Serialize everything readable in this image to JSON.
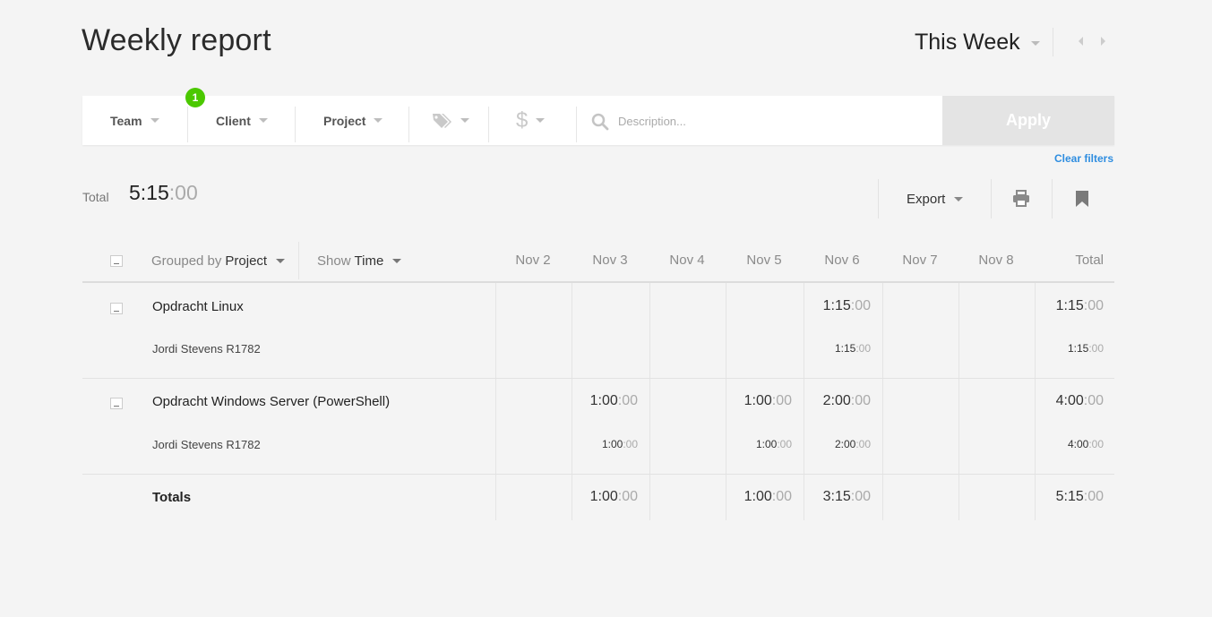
{
  "page": {
    "title": "Weekly report"
  },
  "period": {
    "label": "This Week"
  },
  "filters": {
    "team": "Team",
    "team_badge": "1",
    "client": "Client",
    "project": "Project",
    "tags_icon": "tag-icon",
    "billable_icon": "dollar-icon",
    "description_placeholder": "Description...",
    "apply": "Apply",
    "clear": "Clear filters"
  },
  "summary": {
    "total_label": "Total",
    "total_main": "5:15",
    "total_sec": ":00"
  },
  "toolbar": {
    "export": "Export",
    "print_icon": "print-icon",
    "bookmark_icon": "bookmark-icon"
  },
  "table": {
    "grouped_prefix": "Grouped by",
    "grouped_value": "Project",
    "show_prefix": "Show",
    "show_value": "Time",
    "days": [
      "Nov 2",
      "Nov 3",
      "Nov 4",
      "Nov 5",
      "Nov 6",
      "Nov 7",
      "Nov 8"
    ],
    "total_header": "Total",
    "groups": [
      {
        "name": "Opdracht Linux",
        "times": {
          "nov6": {
            "main": "1:15",
            "sec": ":00"
          },
          "total": {
            "main": "1:15",
            "sec": ":00"
          }
        },
        "user": "Jordi Stevens R1782",
        "user_times": {
          "nov6": {
            "main": "1:15",
            "sec": ":00"
          },
          "total": {
            "main": "1:15",
            "sec": ":00"
          }
        }
      },
      {
        "name": "Opdracht Windows Server (PowerShell)",
        "times": {
          "nov3": {
            "main": "1:00",
            "sec": ":00"
          },
          "nov5": {
            "main": "1:00",
            "sec": ":00"
          },
          "nov6": {
            "main": "2:00",
            "sec": ":00"
          },
          "total": {
            "main": "4:00",
            "sec": ":00"
          }
        },
        "user": "Jordi Stevens R1782",
        "user_times": {
          "nov3": {
            "main": "1:00",
            "sec": ":00"
          },
          "nov5": {
            "main": "1:00",
            "sec": ":00"
          },
          "nov6": {
            "main": "2:00",
            "sec": ":00"
          },
          "total": {
            "main": "4:00",
            "sec": ":00"
          }
        }
      }
    ],
    "totals_label": "Totals",
    "totals": {
      "nov3": {
        "main": "1:00",
        "sec": ":00"
      },
      "nov5": {
        "main": "1:00",
        "sec": ":00"
      },
      "nov6": {
        "main": "3:15",
        "sec": ":00"
      },
      "total": {
        "main": "5:15",
        "sec": ":00"
      }
    }
  },
  "colors": {
    "badge": "#4bc800",
    "link": "#2e8de0",
    "apply_disabled": "#e4e4e4"
  }
}
